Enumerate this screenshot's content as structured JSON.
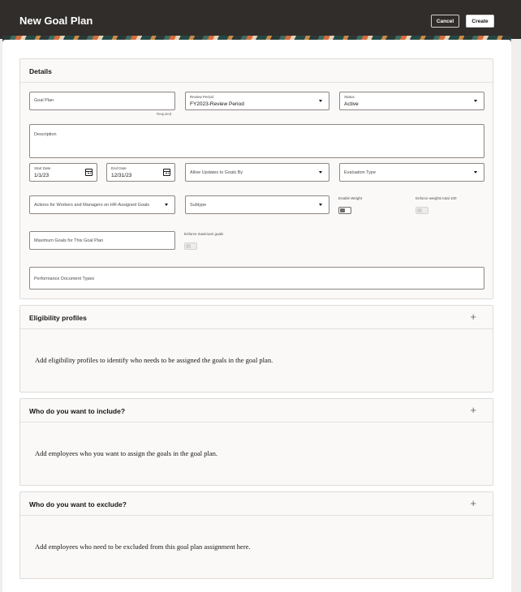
{
  "header": {
    "title": "New Goal Plan",
    "cancel_label": "Cancel",
    "create_label": "Create"
  },
  "details": {
    "title": "Details",
    "goal_plan": {
      "label": "Goal Plan",
      "required": "Required"
    },
    "review_period": {
      "label": "Review Period",
      "value": "FY2023-Review Period"
    },
    "status": {
      "label": "Status",
      "value": "Active"
    },
    "description": {
      "label": "Description"
    },
    "start_date": {
      "label": "Start Date",
      "value": "1/1/23"
    },
    "end_date": {
      "label": "End Date",
      "value": "12/31/23"
    },
    "allow_updates": {
      "label": "Allow Updates to Goals By"
    },
    "evaluation_type": {
      "label": "Evaluation Type"
    },
    "actions": {
      "label": "Actions for Workers and Managers on HR-Assigned Goals"
    },
    "subtype": {
      "label": "Subtype"
    },
    "enable_weight": {
      "label": "Enable Weight",
      "enabled": true
    },
    "enforce_weights": {
      "label": "Enforce weights total 100",
      "enabled": false
    },
    "max_goals": {
      "label": "Maximum Goals for This Goal Plan"
    },
    "enforce_max": {
      "label": "Enforce maximum goals",
      "enabled": false
    },
    "perf_doc_types": {
      "label": "Performance Document Types"
    }
  },
  "eligibility": {
    "title": "Eligibility profiles",
    "text": "Add eligibility profiles to identify who needs to be assigned the goals in the goal plan."
  },
  "include": {
    "title": "Who do you want to include?",
    "text": "Add employees who you want to assign the goals in the goal plan."
  },
  "exclude": {
    "title": "Who do you want to exclude?",
    "text": "Add employees who need to be excluded from this goal plan assignment here."
  }
}
